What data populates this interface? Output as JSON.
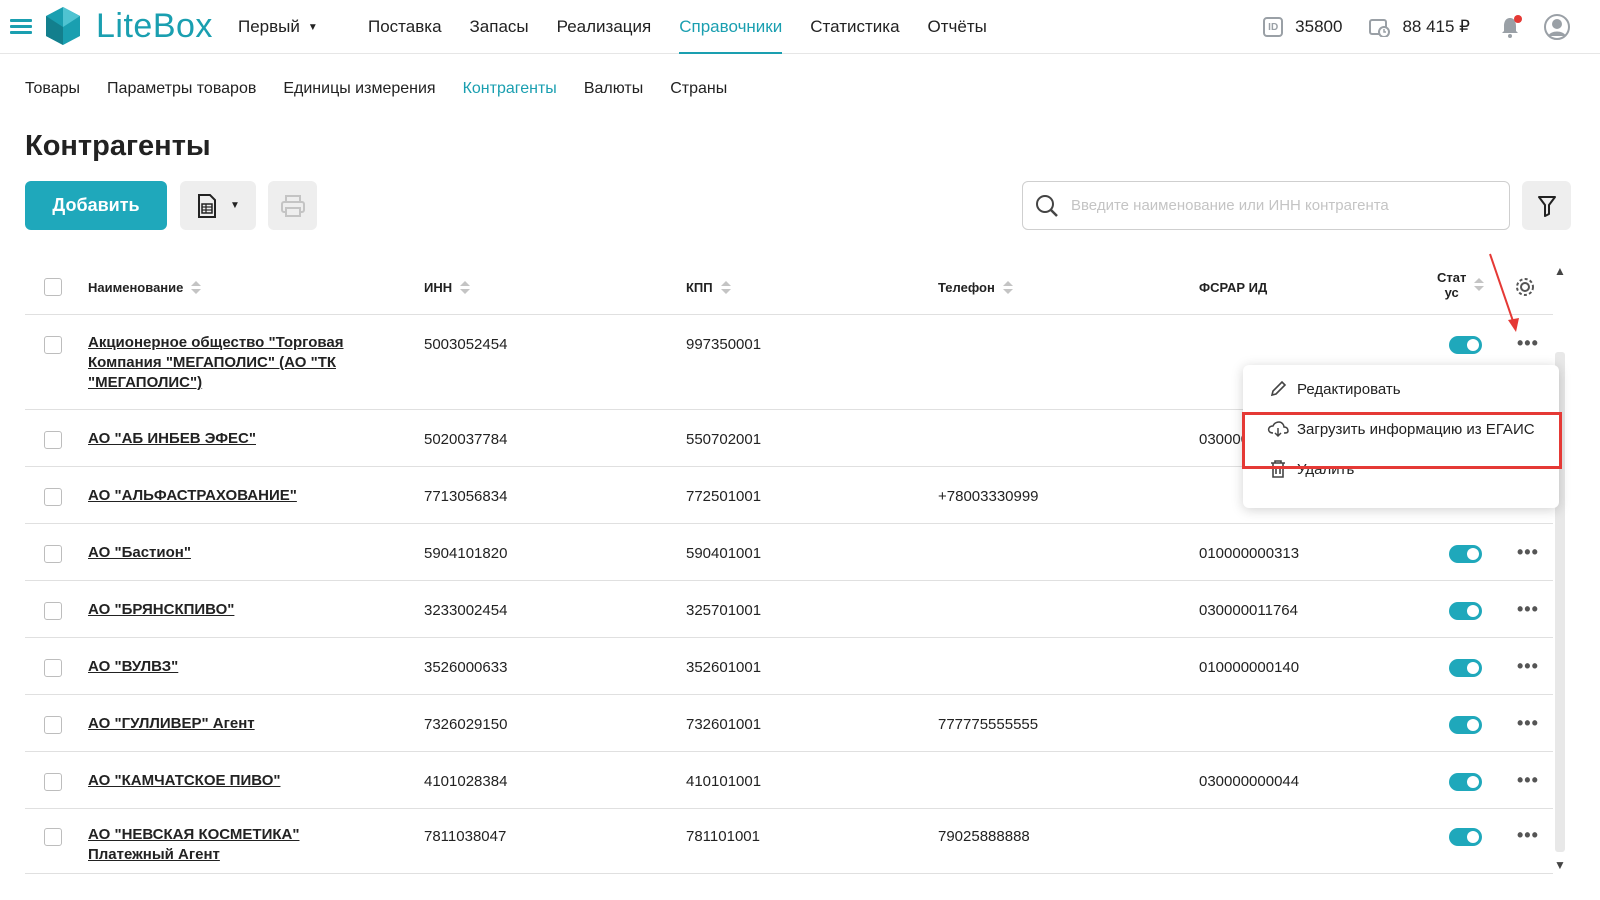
{
  "app": {
    "logo_text": "LiteBox",
    "org": "Первый",
    "nav": [
      "Поставка",
      "Запасы",
      "Реализация",
      "Справочники",
      "Статистика",
      "Отчёты"
    ],
    "active_nav": "Справочники",
    "id_value": "35800",
    "balance": "88 415 ₽",
    "accent": "#1fa8bb"
  },
  "subnav": {
    "items": [
      "Товары",
      "Параметры товаров",
      "Единицы измерения",
      "Контрагенты",
      "Валюты",
      "Страны"
    ],
    "active": "Контрагенты"
  },
  "page": {
    "title": "Контрагенты",
    "add_label": "Добавить",
    "search_placeholder": "Введите наименование или ИНН контрагента"
  },
  "table": {
    "headers": {
      "name": "Наименование",
      "inn": "ИНН",
      "kpp": "КПП",
      "phone": "Телефон",
      "fsrar": "ФСРАР ИД",
      "status": "Стат ус"
    },
    "rows": [
      {
        "name": "Акционерное общество \"Торговая Компания \"МЕГАПОЛИС\" (АО \"ТК \"МЕГАПОЛИС\")",
        "inn": "5003052454",
        "kpp": "997350001",
        "phone": "",
        "fsrar": "",
        "active": true
      },
      {
        "name": "АО \"АБ ИНБЕВ ЭФЕС\"",
        "inn": "5020037784",
        "kpp": "550702001",
        "phone": "",
        "fsrar": "03000000",
        "active": true
      },
      {
        "name": "АО \"АЛЬФАСТРАХОВАНИЕ\"",
        "inn": "7713056834",
        "kpp": "772501001",
        "phone": "+78003330999",
        "fsrar": "",
        "active": true
      },
      {
        "name": "АО \"Бастион\"",
        "inn": "5904101820",
        "kpp": "590401001",
        "phone": "",
        "fsrar": "010000000313",
        "active": true
      },
      {
        "name": "АО \"БРЯНСКПИВО\"",
        "inn": "3233002454",
        "kpp": "325701001",
        "phone": "",
        "fsrar": "030000011764",
        "active": true
      },
      {
        "name": "АО \"ВУЛВЗ\"",
        "inn": "3526000633",
        "kpp": "352601001",
        "phone": "",
        "fsrar": "010000000140",
        "active": true
      },
      {
        "name": "АО \"ГУЛЛИВЕР\" Агент",
        "inn": "7326029150",
        "kpp": "732601001",
        "phone": "777775555555",
        "fsrar": "",
        "active": true
      },
      {
        "name": "АО \"КАМЧАТСКОЕ ПИВО\"",
        "inn": "4101028384",
        "kpp": "410101001",
        "phone": "",
        "fsrar": "030000000044",
        "active": true
      },
      {
        "name": "АО \"НЕВСКАЯ КОСМЕТИКА\" Платежный Агент",
        "inn": "7811038047",
        "kpp": "781101001",
        "phone": "79025888888",
        "fsrar": "",
        "active": true
      }
    ]
  },
  "context_menu": {
    "edit": "Редактировать",
    "load_egais": "Загрузить информацию из ЕГАИС",
    "delete": "Удалить"
  }
}
